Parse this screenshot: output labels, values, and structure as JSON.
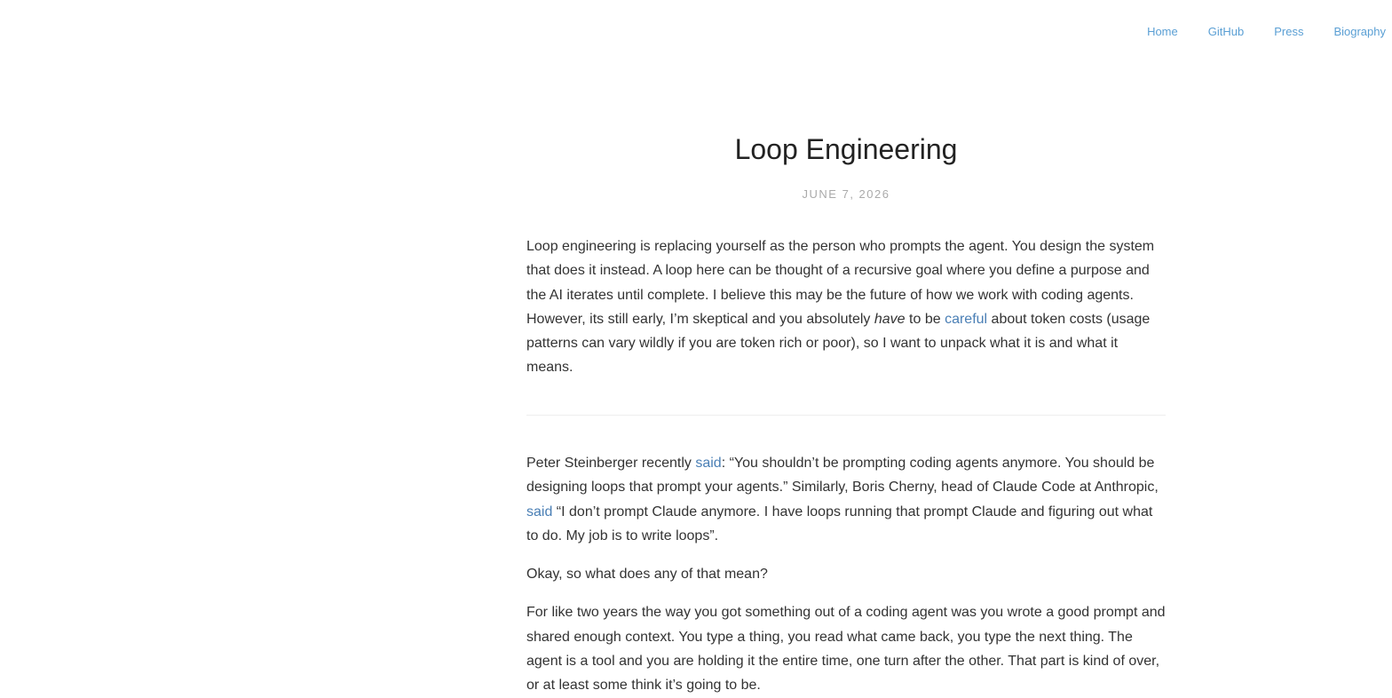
{
  "nav": {
    "items": [
      "Home",
      "GitHub",
      "Press",
      "Biography"
    ]
  },
  "article": {
    "title": "Loop Engineering",
    "date": "JUNE 7, 2026",
    "intro": {
      "part1": "Loop engineering is replacing yourself as the person who prompts the agent. You design the system that does it instead. A loop here can be thought of a recursive goal where you define a purpose and the AI iterates until complete. I believe this may be the future of how we work with coding agents. However, its still early, I’m skeptical and you absolutely ",
      "emphasis": "have",
      "part2": " to be ",
      "link": "careful",
      "part3": " about token costs (usage patterns can vary wildly if you are token rich or poor), so I want to unpack what it is and what it means."
    },
    "p1": {
      "part1": "Peter Steinberger recently ",
      "link1": "said",
      "part2": ": “You shouldn’t be prompting coding agents anymore. You should be designing loops that prompt your agents.” Similarly, Boris Cherny, head of Claude Code at Anthropic, ",
      "link2": "said",
      "part3": " “I don’t prompt Claude anymore. I have loops running that prompt Claude and figuring out what to do. My job is to write loops”."
    },
    "p2": "Okay, so what does any of that mean?",
    "p3": "For like two years the way you got something out of a coding agent was you wrote a good prompt and shared enough context. You type a thing, you read what came back, you type the next thing. The agent is a tool and you are holding it the entire time, one turn after the other. That part is kind of over, or at least some think it’s going to be."
  },
  "colors": {
    "link": "#4a7fb5",
    "nav_link": "#5a9fd4",
    "text": "#333333",
    "date": "#aaaaaa"
  }
}
